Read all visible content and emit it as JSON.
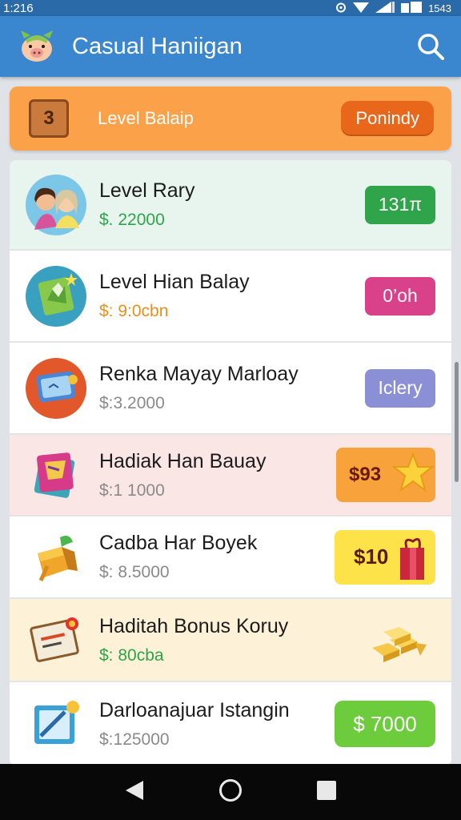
{
  "status_bar": {
    "time": "1:216",
    "right_text": "1543"
  },
  "app_bar": {
    "title": "Casual Haniigan",
    "logo_icon": "pig-mascot-icon",
    "search_icon": "search-icon"
  },
  "level_banner": {
    "badge": "3",
    "title": "Level Balaip",
    "button": "Ponindy"
  },
  "items": [
    {
      "title": "Level Rary",
      "price": "$. 22000",
      "action": "131π",
      "icon": "couple-avatar-icon"
    },
    {
      "title": "Level Hian Balay",
      "price": "$: 9:0cbn",
      "action": "0’oh",
      "icon": "map-icon"
    },
    {
      "title": "Renka Mayay Marloay",
      "price": "$:3.2000",
      "action": "Iclery",
      "icon": "tablet-icon"
    },
    {
      "title": "Hadiak Han Bauay",
      "price": "$:1 1000",
      "action": "$93",
      "icon": "notebook-icon"
    },
    {
      "title": "Cadba Har Boyek",
      "price": "$: 8.5000",
      "action": "$10",
      "icon": "gift-box-icon"
    },
    {
      "title": "Haditah Bonus Koruy",
      "price": "$: 80cba",
      "action": "",
      "icon": "certificate-icon",
      "action_icon": "gold-bars-icon"
    },
    {
      "title": "Darloanajuar Istangin",
      "price": "$:125000",
      "action": "$ 7000",
      "icon": "pencil-card-icon"
    }
  ],
  "colors": {
    "app_bar": "#3a86cf",
    "banner": "#fba14a",
    "green": "#2fa44a",
    "pink": "#d9428a",
    "lavender": "#8b8fd6",
    "orange": "#f7a23a",
    "yellow": "#fde24a",
    "lime": "#6ccc3c"
  },
  "nav": {
    "back": "back-icon",
    "home": "home-icon",
    "recents": "recents-icon"
  }
}
